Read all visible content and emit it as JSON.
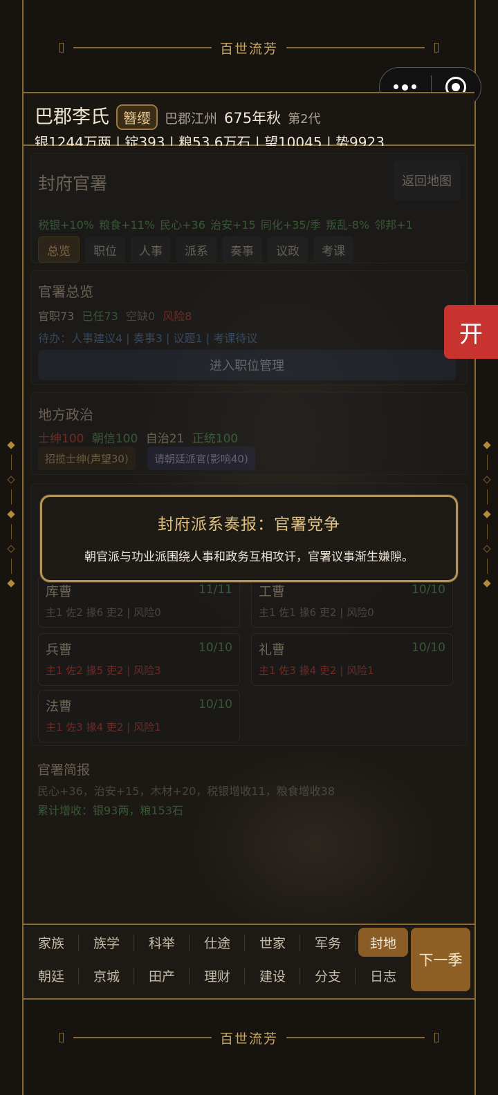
{
  "banner": {
    "title": "百世流芳"
  },
  "header": {
    "clan": "巴郡李氏",
    "rank": "簪缨",
    "province": "巴郡江州",
    "year": "675年秋",
    "generation": "第2代",
    "resources": "银1244万两 | 锭393 | 粮53.6万石 | 望10045 | 势9923"
  },
  "office": {
    "title": "封府官署",
    "back_button": "返回地图",
    "stats": "税银+10% 粮食+11% 民心+36 治安+15 同化+35/季 叛乱-8% 邻邦+1",
    "tabs": [
      "总览",
      "职位",
      "人事",
      "派系",
      "奏事",
      "议政",
      "考课"
    ]
  },
  "overview": {
    "title": "官署总览",
    "officials": "官职73",
    "appointed": "已任73",
    "vacant": "空缺0",
    "risk": "风险8",
    "pending": "待办：人事建议4 | 奏事3 | 议题1 | 考课待议",
    "manage_button": "进入职位管理"
  },
  "local": {
    "title": "地方政治",
    "gentry": "士绅100",
    "court_trust": "朝信100",
    "autonomy": "自治21",
    "legitimacy": "正统100",
    "recruit_button": "招揽士绅(声望30)",
    "request_button": "请朝廷派官(影响40)"
  },
  "departments": [
    {
      "name": "库曹",
      "count": "11/11",
      "staff": "主1 佐2 掾6 吏2 | 风险0",
      "risk": false
    },
    {
      "name": "工曹",
      "count": "10/10",
      "staff": "主1 佐1 掾6 吏2 | 风险0",
      "risk": false
    },
    {
      "name": "兵曹",
      "count": "10/10",
      "staff": "主1 佐2 掾5 吏2 | 风险3",
      "risk": true
    },
    {
      "name": "礼曹",
      "count": "10/10",
      "staff": "主1 佐3 掾4 吏2 | 风险1",
      "risk": true
    },
    {
      "name": "法曹",
      "count": "10/10",
      "staff": "主1 佐3 掾4 吏2 | 风险1",
      "risk": true
    }
  ],
  "brief": {
    "title": "官署简报",
    "line1": "民心+36，治安+15，木材+20，税银增收11，粮食增收38",
    "line2": "累计增收：银93两，粮153石"
  },
  "modal": {
    "title": "封府派系奏报：官署党争",
    "body": "朝官派与功业派围绕人事和政务互相攻讦，官署议事渐生嫌隙。"
  },
  "open_button": "开",
  "nav": {
    "row1": [
      "家族",
      "族学",
      "科举",
      "仕途",
      "世家",
      "军务",
      "封地"
    ],
    "row2": [
      "朝廷",
      "京城",
      "田产",
      "理财",
      "建设",
      "分支",
      "日志"
    ],
    "active": "封地",
    "next_season": "下一季"
  },
  "colors": {
    "gold": "#8a6a33",
    "green": "#4f8a52",
    "red": "#b03a34",
    "active_nav": "#8a5c26"
  }
}
